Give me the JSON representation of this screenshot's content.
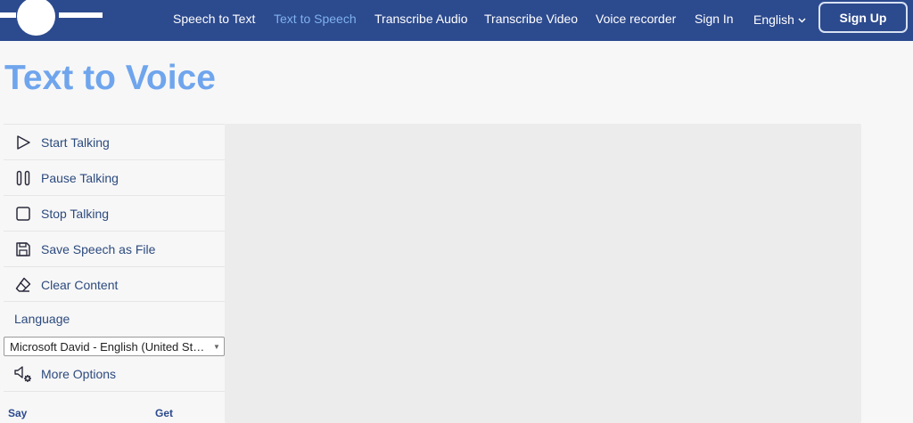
{
  "nav": {
    "links": [
      "Speech to Text",
      "Text to Speech",
      "Transcribe Audio",
      "Transcribe Video",
      "Voice recorder",
      "Sign In"
    ],
    "active_link": "Text to Speech",
    "language": "English",
    "signup_label": "Sign Up"
  },
  "page": {
    "title": "Text to Voice"
  },
  "sidebar": {
    "items": [
      {
        "label": "Start Talking",
        "icon": "play-icon"
      },
      {
        "label": "Pause Talking",
        "icon": "pause-icon"
      },
      {
        "label": "Stop Talking",
        "icon": "stop-icon"
      },
      {
        "label": "Save Speech as File",
        "icon": "save-icon"
      },
      {
        "label": "Clear Content",
        "icon": "eraser-icon"
      }
    ],
    "language_label": "Language",
    "voice_selected": "Microsoft David - English (United States)",
    "more_options_label": "More Options",
    "more_options_icon": "speaker-settings-icon",
    "footer_left": "Say",
    "footer_right": "Get"
  },
  "colors": {
    "nav_bg": "#2c4a8e",
    "title": "#6fa5ed",
    "active_link": "#7fb2ee",
    "text_area_bg": "#ececec"
  }
}
